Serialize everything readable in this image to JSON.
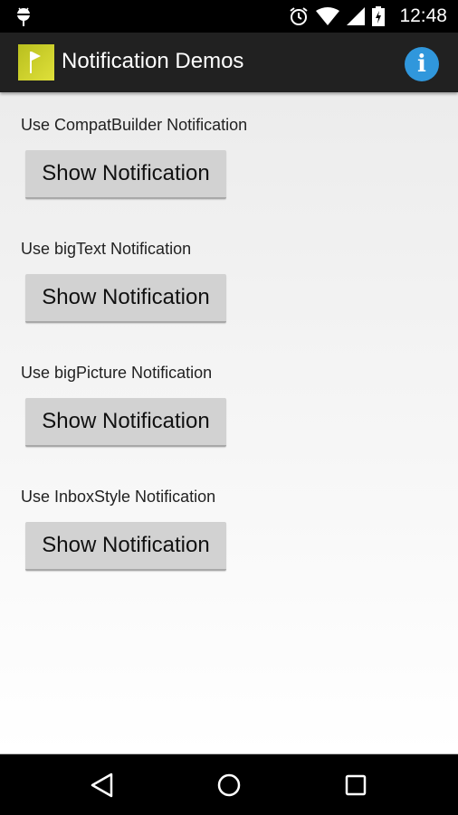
{
  "status_bar": {
    "time": "12:48",
    "icons": [
      "android-icon",
      "alarm-icon",
      "wifi-icon",
      "signal-icon",
      "battery-charging-icon"
    ]
  },
  "action_bar": {
    "title": "Notification Demos",
    "logo_icon": "flag-icon",
    "info_icon": "info-icon",
    "info_glyph": "i"
  },
  "sections": [
    {
      "label": "Use CompatBuilder Notification",
      "button": "Show Notification"
    },
    {
      "label": "Use bigText Notification",
      "button": "Show Notification"
    },
    {
      "label": "Use bigPicture Notification",
      "button": "Show Notification"
    },
    {
      "label": "Use InboxStyle Notification",
      "button": "Show Notification"
    }
  ],
  "nav_bar": {
    "buttons": [
      "back",
      "home",
      "recents"
    ]
  }
}
